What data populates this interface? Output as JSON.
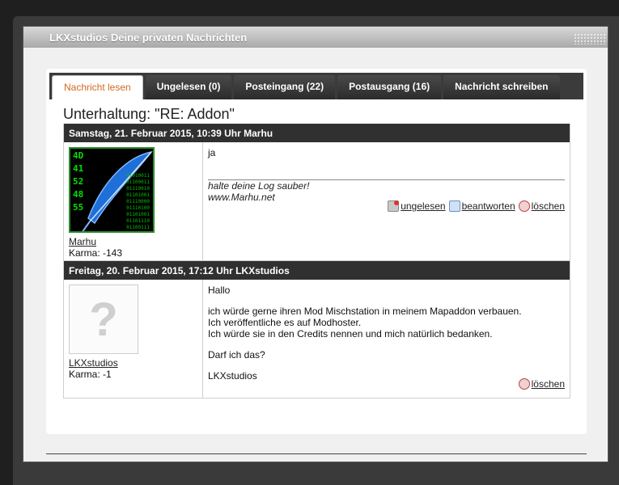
{
  "window": {
    "title": "LKXstudios Deine privaten Nachrichten"
  },
  "tabs": [
    {
      "label": "Nachricht lesen",
      "active": true
    },
    {
      "label": "Ungelesen (0)",
      "active": false
    },
    {
      "label": "Posteingang (22)",
      "active": false
    },
    {
      "label": "Postausgang (16)",
      "active": false
    },
    {
      "label": "Nachricht schreiben",
      "active": false
    }
  ],
  "conversation_title": "Unterhaltung: \"RE: Addon\"",
  "messages": [
    {
      "header": "Samstag, 21. Februar 2015, 10:39 Uhr Marhu",
      "user": "Marhu",
      "karma": "Karma: -143",
      "avatar_numbers": [
        "4D",
        "41",
        "52",
        "48",
        "55"
      ],
      "avatar_bits": [
        "01010011",
        "01100011",
        "01110010",
        "01101001",
        "01110000",
        "01110100",
        "01101001",
        "01101110",
        "01100111"
      ],
      "text": [
        "ja"
      ],
      "signature_line": "halte deine Log sauber!",
      "signature_link": "www.Marhu.net",
      "actions": {
        "unread": "ungelesen",
        "reply": "beantworten",
        "delete": "löschen"
      }
    },
    {
      "header": "Freitag, 20. Februar 2015, 17:12 Uhr LKXstudios",
      "user": "LKXstudios",
      "karma": "Karma: -1",
      "text": [
        "Hallo",
        "ich würde gerne ihren Mod Mischstation in meinem Mapaddon verbauen.",
        "Ich veröffentliche es auf Modhoster.",
        "Ich würde sie in den Credits nennen und mich natürlich bedanken.",
        "Darf ich das?",
        "LKXstudios"
      ],
      "actions": {
        "delete": "löschen"
      }
    }
  ],
  "colors": {
    "accent": "#d2691e",
    "header_bg": "#303030",
    "tab_bg": "#3b3b3b"
  }
}
